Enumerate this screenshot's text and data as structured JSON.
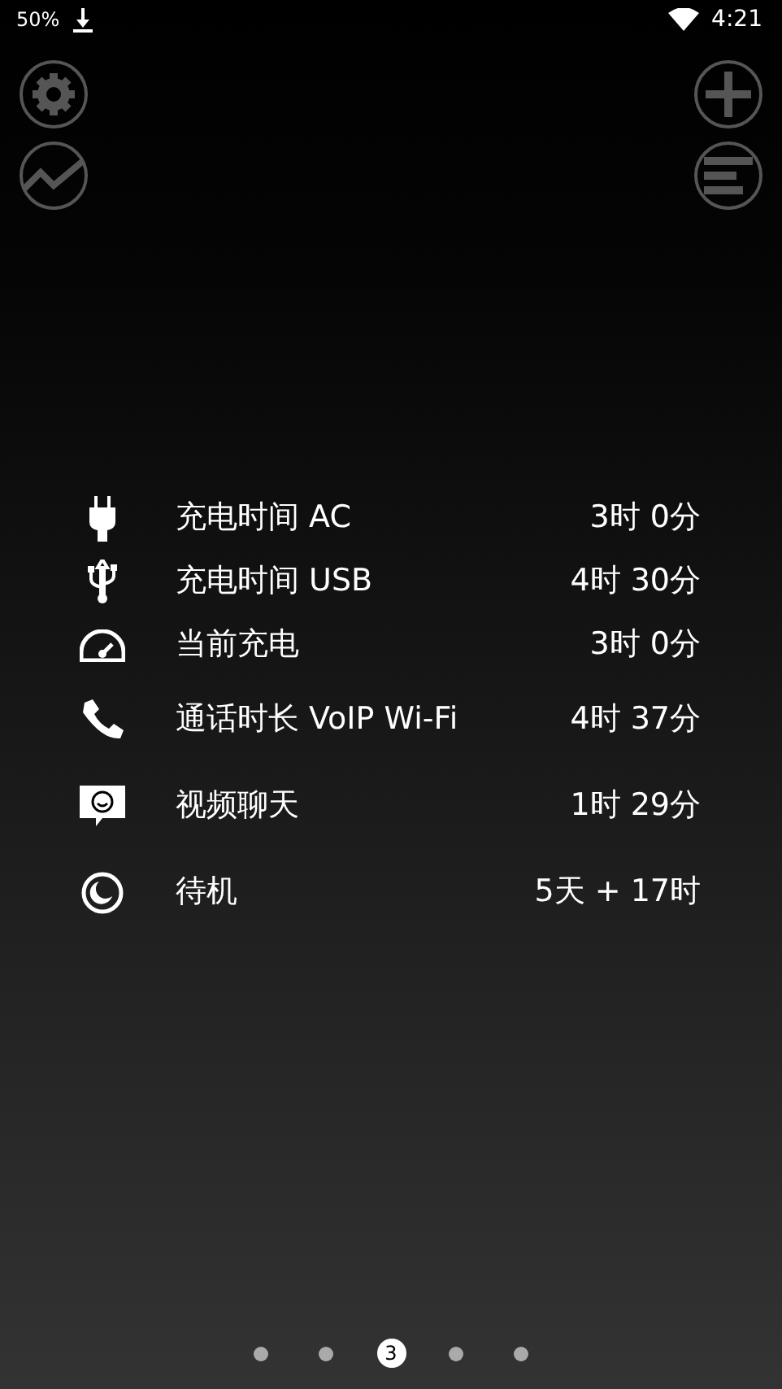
{
  "status_bar": {
    "battery": "50%",
    "time": "4:21"
  },
  "rows": [
    {
      "kind": "plug",
      "label": "充电时间 AC",
      "value": "3时 0分"
    },
    {
      "kind": "usb",
      "label": "充电时间 USB",
      "value": "4时 30分"
    },
    {
      "kind": "gauge",
      "label": "当前充电",
      "value": "3时 0分"
    },
    {
      "kind": "phone",
      "label": "通话时长 VoIP Wi-Fi",
      "value": "4时 37分"
    },
    {
      "kind": "chat",
      "label": "视频聊天",
      "value": "1时 29分"
    },
    {
      "kind": "moon",
      "label": "待机",
      "value": "5天 + 17时"
    }
  ],
  "pager": [
    {
      "selected": false
    },
    {
      "selected": false
    },
    {
      "selected": true,
      "label": "3"
    },
    {
      "selected": false
    },
    {
      "selected": false
    }
  ]
}
